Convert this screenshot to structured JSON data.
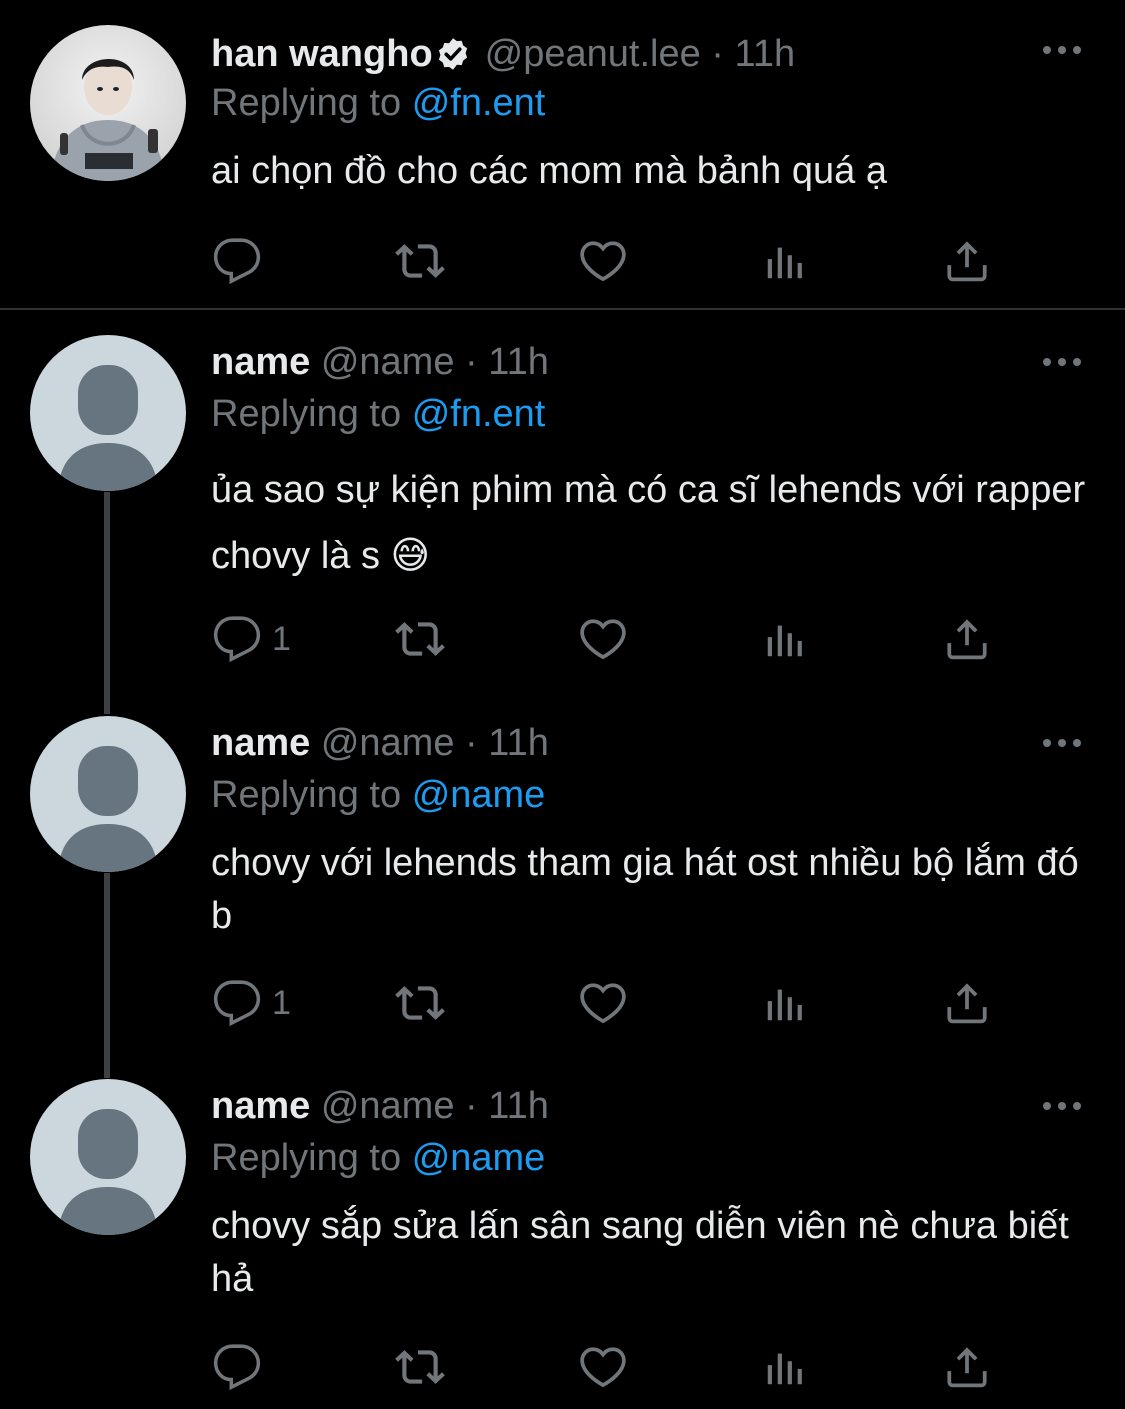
{
  "tweets": [
    {
      "display_name": "han wangho",
      "verified": true,
      "handle": "@peanut.lee",
      "separator": "·",
      "time": "11h",
      "replying_label": "Replying to",
      "replying_to": "@fn.ent",
      "text": "ai chọn đồ cho các mom mà bảnh quá ạ",
      "reply_count": "",
      "avatar": "profile-photo"
    },
    {
      "display_name": "name",
      "verified": false,
      "handle": "@name",
      "separator": "·",
      "time": "11h",
      "replying_label": "Replying to",
      "replying_to": "@fn.ent",
      "text": "ủa sao sự kiện phim mà có ca sĩ lehends với rapper chovy là s 😅",
      "reply_count": "1",
      "avatar": "default-avatar"
    },
    {
      "display_name": "name",
      "verified": false,
      "handle": "@name",
      "separator": "·",
      "time": "11h",
      "replying_label": "Replying to",
      "replying_to": "@name",
      "text": "chovy với lehends tham gia hát ost nhiều bộ lắm đó b",
      "reply_count": "1",
      "avatar": "default-avatar"
    },
    {
      "display_name": "name",
      "verified": false,
      "handle": "@name",
      "separator": "·",
      "time": "11h",
      "replying_label": "Replying to",
      "replying_to": "@name",
      "text": "chovy sắp sửa lấn sân sang diễn viên nè chưa biết hả",
      "reply_count": "",
      "avatar": "default-avatar"
    }
  ],
  "icons": {
    "reply": "reply-icon",
    "retweet": "retweet-icon",
    "like": "heart-icon",
    "views": "views-icon",
    "share": "share-icon",
    "more": "more-icon",
    "verified": "verified-badge-icon"
  },
  "colors": {
    "background": "#000000",
    "text": "#e7e9ea",
    "muted": "#71767b",
    "link": "#1d9bf0",
    "divider": "#2f3336"
  }
}
